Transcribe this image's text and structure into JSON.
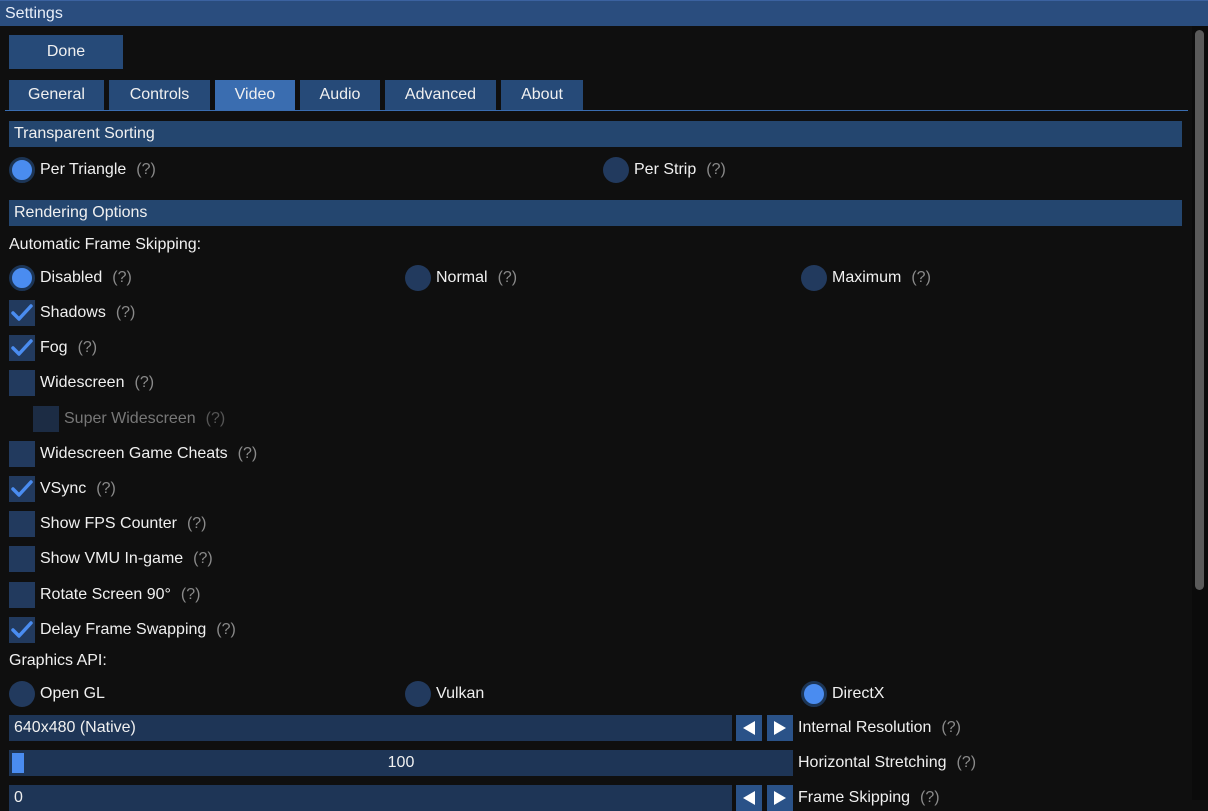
{
  "window": {
    "title": "Settings"
  },
  "toolbar": {
    "done_label": "Done"
  },
  "tabs": [
    {
      "label": "General",
      "active": false
    },
    {
      "label": "Controls",
      "active": false
    },
    {
      "label": "Video",
      "active": true
    },
    {
      "label": "Audio",
      "active": false
    },
    {
      "label": "Advanced",
      "active": false
    },
    {
      "label": "About",
      "active": false
    }
  ],
  "help_marker": "(?)",
  "transparent_sorting": {
    "header": "Transparent Sorting",
    "options": [
      {
        "label": "Per Triangle",
        "selected": true
      },
      {
        "label": "Per Strip",
        "selected": false
      }
    ]
  },
  "rendering_options": {
    "header": "Rendering Options",
    "frame_skipping_label": "Automatic Frame Skipping:",
    "frame_skipping_options": [
      {
        "label": "Disabled",
        "selected": true
      },
      {
        "label": "Normal",
        "selected": false
      },
      {
        "label": "Maximum",
        "selected": false
      }
    ],
    "checkboxes": [
      {
        "label": "Shadows",
        "checked": true,
        "enabled": true
      },
      {
        "label": "Fog",
        "checked": true,
        "enabled": true
      },
      {
        "label": "Widescreen",
        "checked": false,
        "enabled": true
      },
      {
        "label": "Super Widescreen",
        "checked": false,
        "enabled": false
      },
      {
        "label": "Widescreen Game Cheats",
        "checked": false,
        "enabled": true
      },
      {
        "label": "VSync",
        "checked": true,
        "enabled": true
      },
      {
        "label": "Show FPS Counter",
        "checked": false,
        "enabled": true
      },
      {
        "label": "Show VMU In-game",
        "checked": false,
        "enabled": true
      },
      {
        "label": "Rotate Screen 90°",
        "checked": false,
        "enabled": true
      },
      {
        "label": "Delay Frame Swapping",
        "checked": true,
        "enabled": true
      }
    ],
    "graphics_api_label": "Graphics API:",
    "graphics_api_options": [
      {
        "label": "Open GL",
        "selected": false
      },
      {
        "label": "Vulkan",
        "selected": false
      },
      {
        "label": "DirectX",
        "selected": true
      }
    ],
    "internal_resolution": {
      "value": "640x480 (Native)",
      "label": "Internal Resolution"
    },
    "horizontal_stretching": {
      "value": "100",
      "label": "Horizontal Stretching"
    },
    "frame_skipping": {
      "value": "0",
      "label": "Frame Skipping"
    }
  },
  "colors": {
    "accent": "#4a8cf0",
    "header_bg": "#24466f",
    "tab_active": "#3a6db0",
    "tab_bg": "#264a78"
  }
}
